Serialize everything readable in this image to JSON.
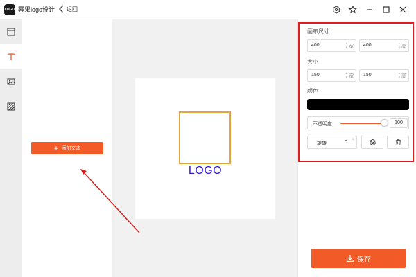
{
  "app": {
    "logo_badge": "LOGO",
    "title": "幂果logo设计",
    "back_label": "返回"
  },
  "window_icons": [
    "settings-icon",
    "star-icon",
    "minimize-icon",
    "maximize-icon",
    "close-icon"
  ],
  "toolbar": {
    "tools": [
      {
        "name": "layout-icon",
        "active": false
      },
      {
        "name": "text-icon",
        "active": true
      },
      {
        "name": "image-icon",
        "active": false
      },
      {
        "name": "pattern-icon",
        "active": false
      }
    ]
  },
  "text_panel": {
    "add_text_label": "添加文本"
  },
  "canvas": {
    "text": "LOGO",
    "text_color": "#2f16d8",
    "box_border_color": "#e6a23c"
  },
  "properties": {
    "canvas_size_label": "画布尺寸",
    "canvas_width": "400",
    "canvas_width_unit": "宽",
    "canvas_height": "400",
    "canvas_height_unit": "高",
    "size_label": "大小",
    "size_width": "150",
    "size_width_unit": "宽",
    "size_height": "150",
    "size_height_unit": "高",
    "color_label": "颜色",
    "color_value": "#000000",
    "opacity_label": "不透明度",
    "opacity_value": "100",
    "rotate_label": "旋转",
    "rotate_value": "0",
    "rotate_unit": "°",
    "highlight_color": "#e11c1c"
  },
  "save": {
    "label": "保存"
  },
  "accent_color": "#f25b28"
}
